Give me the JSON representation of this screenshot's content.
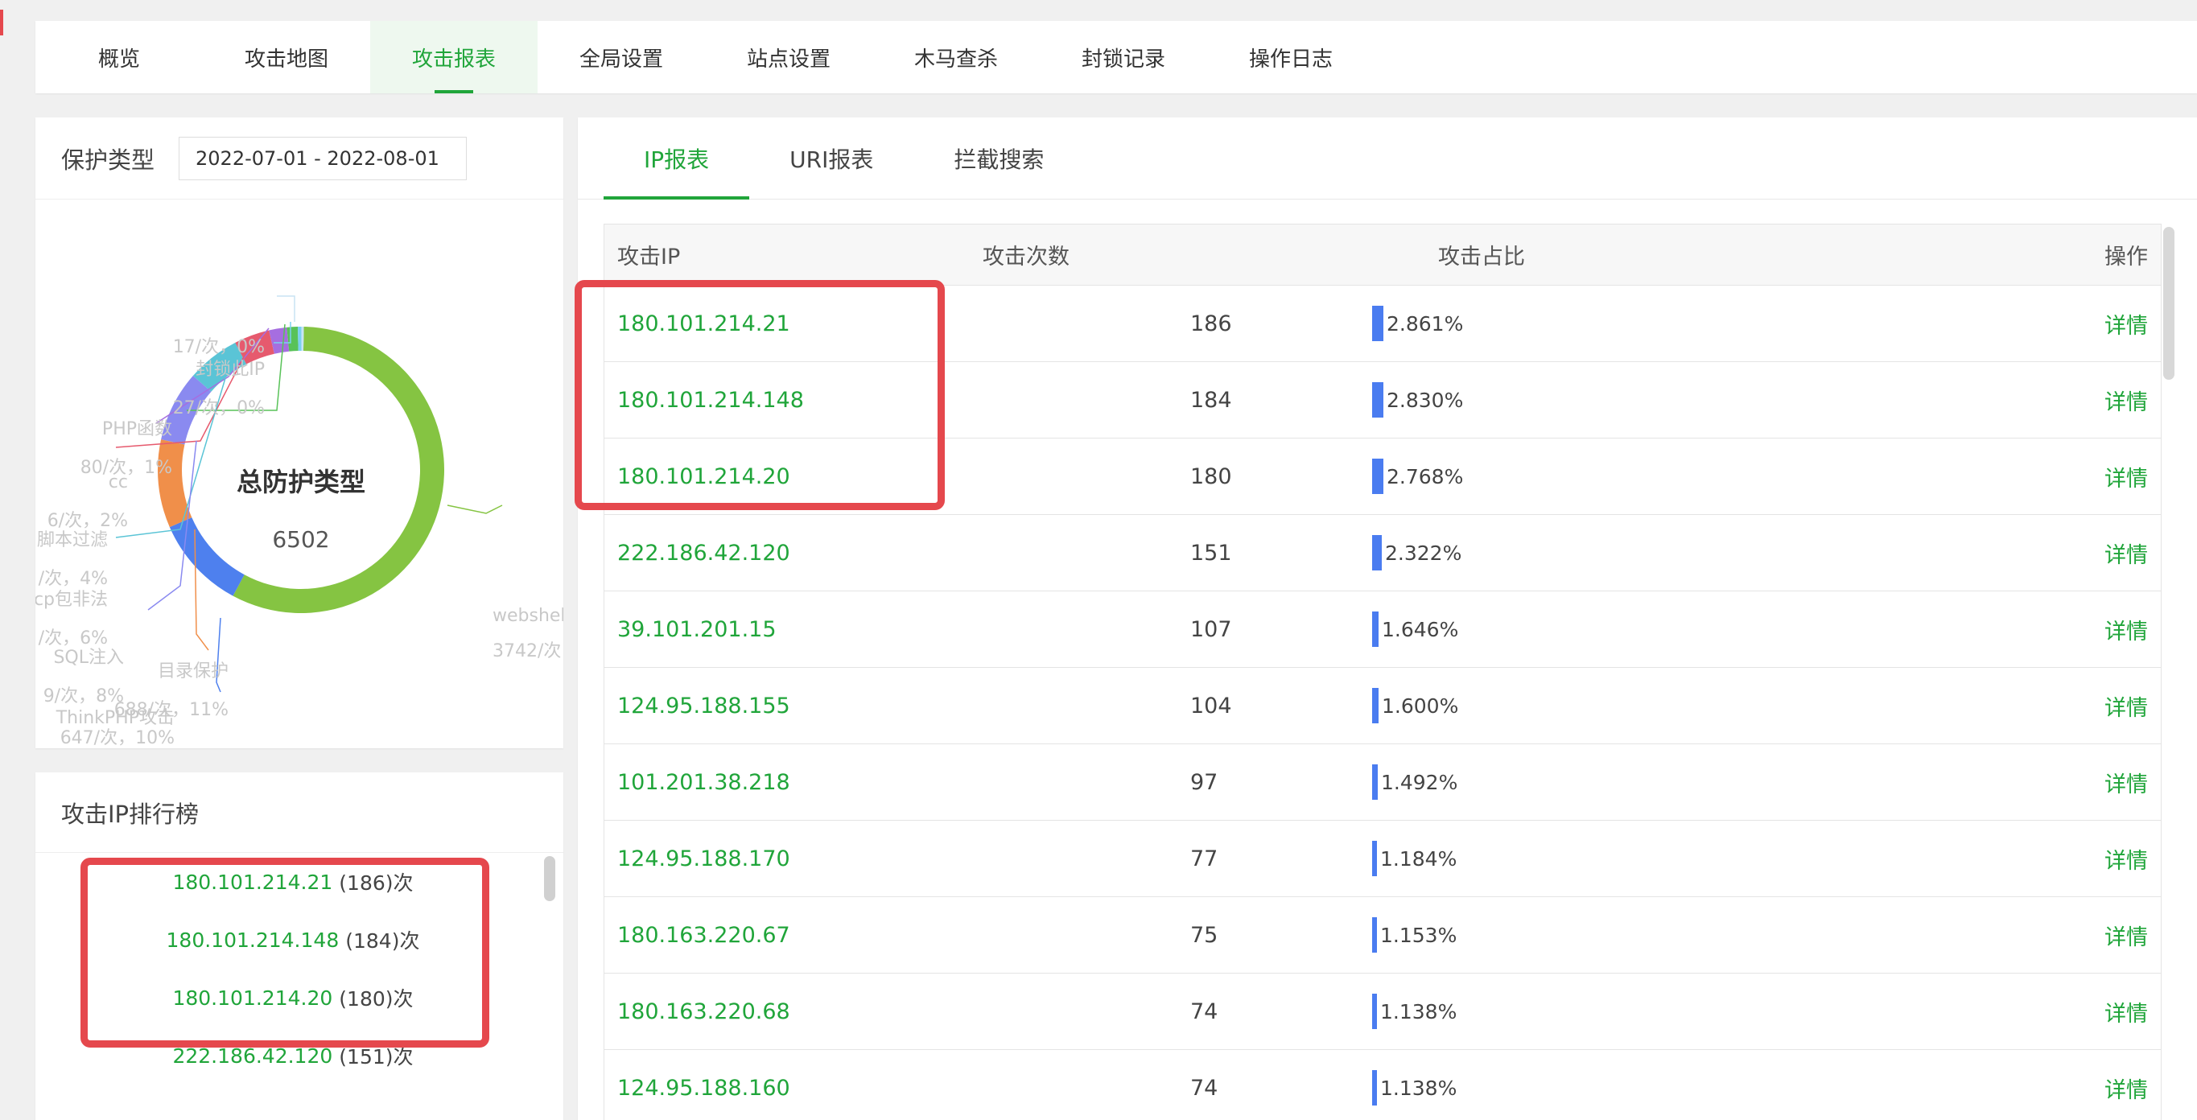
{
  "nav": {
    "tabs": [
      "概览",
      "攻击地图",
      "攻击报表",
      "全局设置",
      "站点设置",
      "木马查杀",
      "封锁记录",
      "操作日志"
    ],
    "active": 2
  },
  "protect_panel": {
    "label": "保护类型",
    "date_range": "2022-07-01 - 2022-08-01",
    "center_title": "总防护类型",
    "total": "6502",
    "labels": {
      "top_cut": "17/次，0%",
      "l1_name": "封锁此IP",
      "l1_val": "27/次，0%",
      "l2_name": "PHP函数",
      "l2_val": "80/次，1%",
      "l3_name": "cc",
      "l3_val": "6/次，2%",
      "l4_name": "脚本过滤",
      "l4_val": "/次，4%",
      "l5_name": "cp包非法",
      "l5_val": "/次，6%",
      "l6_name": "SQL注入",
      "l6_val": "9/次，8%",
      "l7_name": "ThinkPHP攻击",
      "l7_val": "647/次，10%",
      "l8_name": "目录保护",
      "l8_val": "688/次，11%",
      "right_name": "webshel",
      "right_val": "3742/次"
    }
  },
  "chart_data": {
    "type": "pie",
    "title": "总防护类型",
    "total": 6502,
    "slices": [
      {
        "name": "webshel",
        "value": 3742,
        "color": "#85c442"
      },
      {
        "name": "目录保护",
        "value": 688,
        "color": "#4e80ee"
      },
      {
        "name": "ThinkPHP攻击",
        "value": 647,
        "color": "#f08f4a"
      },
      {
        "name": "SQL注入",
        "value": 520,
        "color": "#8a8af0"
      },
      {
        "name": "cp包非法",
        "value": 390,
        "color": "#5ac4d6"
      },
      {
        "name": "脚本过滤",
        "value": 260,
        "color": "#e65a6e"
      },
      {
        "name": "cc",
        "value": 130,
        "color": "#a66ee0"
      },
      {
        "name": "PHP函数",
        "value": 80,
        "color": "#58c258"
      },
      {
        "name": "封锁此IP",
        "value": 27,
        "color": "#7ad0f0"
      },
      {
        "name": "",
        "value": 17,
        "color": "#c8e4f4"
      }
    ]
  },
  "rank_panel": {
    "title": "攻击IP排行榜",
    "items": [
      {
        "ip": "180.101.214.21",
        "count": "(186)次"
      },
      {
        "ip": "180.101.214.148",
        "count": "(184)次"
      },
      {
        "ip": "180.101.214.20",
        "count": "(180)次"
      },
      {
        "ip": "222.186.42.120",
        "count": "(151)次"
      }
    ]
  },
  "main": {
    "tabs": [
      "IP报表",
      "URI报表",
      "拦截搜索"
    ],
    "active": 0,
    "columns": [
      "攻击IP",
      "攻击次数",
      "攻击占比",
      "操作"
    ],
    "rows": [
      {
        "ip": "180.101.214.21",
        "count": "186",
        "ratio": "2.861%",
        "ratio_value": 2.861,
        "op": "详情"
      },
      {
        "ip": "180.101.214.148",
        "count": "184",
        "ratio": "2.830%",
        "ratio_value": 2.83,
        "op": "详情"
      },
      {
        "ip": "180.101.214.20",
        "count": "180",
        "ratio": "2.768%",
        "ratio_value": 2.768,
        "op": "详情"
      },
      {
        "ip": "222.186.42.120",
        "count": "151",
        "ratio": "2.322%",
        "ratio_value": 2.322,
        "op": "详情"
      },
      {
        "ip": "39.101.201.15",
        "count": "107",
        "ratio": "1.646%",
        "ratio_value": 1.646,
        "op": "详情"
      },
      {
        "ip": "124.95.188.155",
        "count": "104",
        "ratio": "1.600%",
        "ratio_value": 1.6,
        "op": "详情"
      },
      {
        "ip": "101.201.38.218",
        "count": "97",
        "ratio": "1.492%",
        "ratio_value": 1.492,
        "op": "详情"
      },
      {
        "ip": "124.95.188.170",
        "count": "77",
        "ratio": "1.184%",
        "ratio_value": 1.184,
        "op": "详情"
      },
      {
        "ip": "180.163.220.67",
        "count": "75",
        "ratio": "1.153%",
        "ratio_value": 1.153,
        "op": "详情"
      },
      {
        "ip": "180.163.220.68",
        "count": "74",
        "ratio": "1.138%",
        "ratio_value": 1.138,
        "op": "详情"
      },
      {
        "ip": "124.95.188.160",
        "count": "74",
        "ratio": "1.138%",
        "ratio_value": 1.138,
        "op": "详情"
      }
    ]
  },
  "colors": {
    "accent": "#20a53a",
    "highlight": "#e5484d",
    "bar": "#4a7cf0"
  }
}
